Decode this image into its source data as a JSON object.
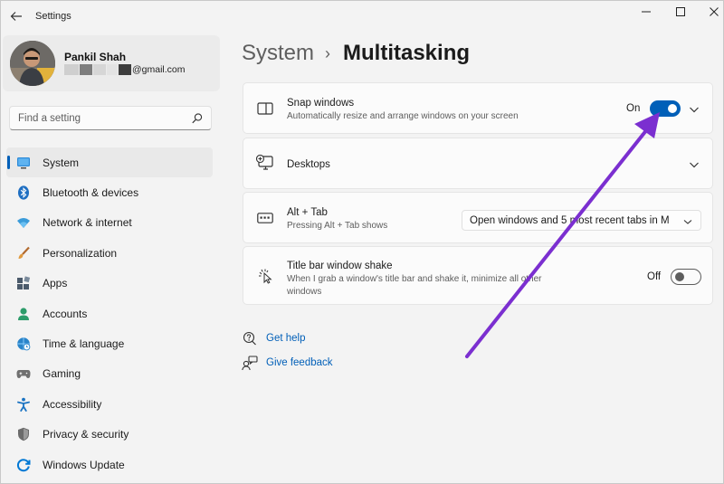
{
  "app": {
    "title": "Settings",
    "back_icon": "back-arrow-icon"
  },
  "window_controls": {
    "minimize": "minimize-icon",
    "maximize": "maximize-icon",
    "close": "close-icon"
  },
  "profile": {
    "name": "Pankil Shah",
    "email_suffix": "@gmail.com"
  },
  "search": {
    "placeholder": "Find a setting"
  },
  "sidebar": {
    "items": [
      {
        "label": "System",
        "icon": "monitor-icon",
        "active": true,
        "color": "#0078d4"
      },
      {
        "label": "Bluetooth & devices",
        "icon": "bluetooth-icon",
        "color": "#0078d4"
      },
      {
        "label": "Network & internet",
        "icon": "wifi-icon",
        "color": "#3a9bd9"
      },
      {
        "label": "Personalization",
        "icon": "brush-icon",
        "color": "#d68a3a"
      },
      {
        "label": "Apps",
        "icon": "apps-icon",
        "color": "#4b5a6b"
      },
      {
        "label": "Accounts",
        "icon": "person-icon",
        "color": "#2d9c6a"
      },
      {
        "label": "Time & language",
        "icon": "globe-clock-icon",
        "color": "#2a84c9"
      },
      {
        "label": "Gaming",
        "icon": "gamepad-icon",
        "color": "#707070"
      },
      {
        "label": "Accessibility",
        "icon": "accessibility-icon",
        "color": "#1a73c2"
      },
      {
        "label": "Privacy & security",
        "icon": "shield-icon",
        "color": "#6b6b6b"
      },
      {
        "label": "Windows Update",
        "icon": "update-icon",
        "color": "#0078d4"
      }
    ]
  },
  "breadcrumb": {
    "parent": "System",
    "separator": "›",
    "current": "Multitasking"
  },
  "cards": {
    "snap": {
      "title": "Snap windows",
      "description": "Automatically resize and arrange windows on your screen",
      "toggle_label": "On",
      "toggle_on": true
    },
    "desktops": {
      "title": "Desktops"
    },
    "alt_tab": {
      "title": "Alt + Tab",
      "description": "Pressing Alt + Tab shows",
      "dropdown_value": "Open windows and 5 most recent tabs in M"
    },
    "shake": {
      "title": "Title bar window shake",
      "description_line1": "When I grab a window's title bar and shake it, minimize all other",
      "description_line2": "windows",
      "toggle_label": "Off",
      "toggle_on": false
    }
  },
  "links": {
    "help": "Get help",
    "feedback": "Give feedback"
  },
  "colors": {
    "accent": "#005fb8",
    "annotation_arrow": "#7b2fd0"
  }
}
